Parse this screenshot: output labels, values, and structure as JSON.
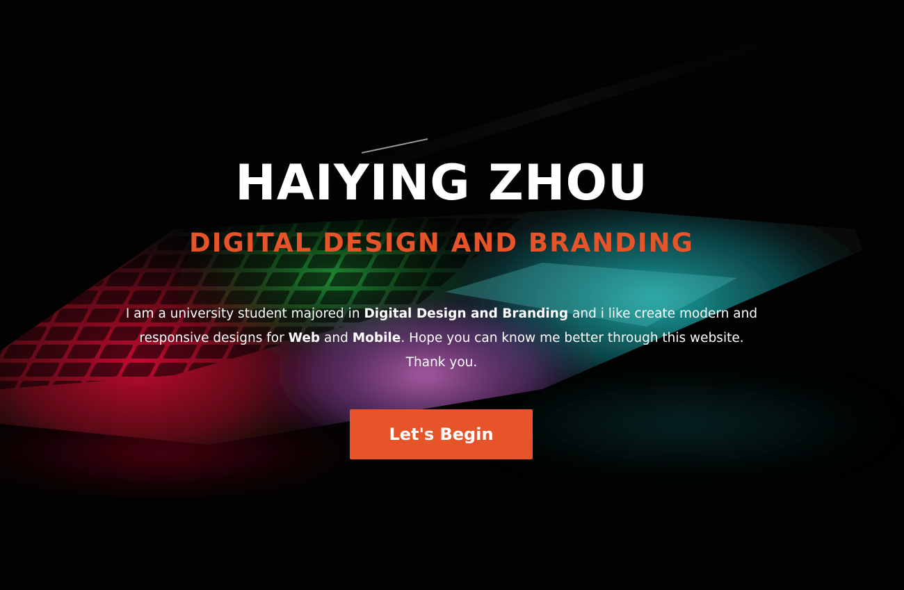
{
  "hero": {
    "name": "HAIYING ZHOU",
    "tagline": "DIGITAL DESIGN AND BRANDING",
    "intro": {
      "t1": "I am a university student majored in ",
      "b1": "Digital Design and Branding",
      "t2": " and i like create modern and responsive designs for ",
      "b2": "Web",
      "t3": " and ",
      "b3": "Mobile",
      "t4": ". Hope you can know me better through this website. Thank you."
    },
    "cta_label": "Let's Begin"
  },
  "colors": {
    "accent": "#e8542a",
    "text": "#ffffff",
    "background": "#030303"
  },
  "background_image": {
    "icon": "laptop-keyboard-photo"
  }
}
